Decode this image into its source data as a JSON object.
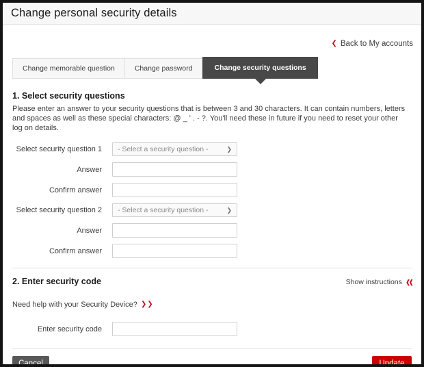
{
  "header": {
    "title": "Change personal security details"
  },
  "back_link": {
    "label": "Back to My accounts",
    "icon": "chevron-left-icon"
  },
  "tabs": [
    {
      "label": "Change memorable question",
      "active": false
    },
    {
      "label": "Change password",
      "active": false
    },
    {
      "label": "Change security questions",
      "active": true
    }
  ],
  "section1": {
    "heading": "1. Select security questions",
    "intro": "Please enter an answer to your security questions that is between 3 and 30 characters. It can contain numbers, letters and spaces as well as these special characters: @ _ ' . - ?. You'll need these in future if you need to reset your other log on details.",
    "fields": [
      {
        "label": "Select security question 1",
        "type": "select",
        "value": "- Select a security question -"
      },
      {
        "label": "Answer",
        "type": "text",
        "value": "",
        "placeholder": ""
      },
      {
        "label": "Confirm answer",
        "type": "text",
        "value": "",
        "placeholder": ""
      },
      {
        "label": "Select security question 2",
        "type": "select",
        "value": "- Select a security question -"
      },
      {
        "label": "Answer",
        "type": "text",
        "value": "",
        "placeholder": ""
      },
      {
        "label": "Confirm answer",
        "type": "text",
        "value": "",
        "placeholder": ""
      }
    ]
  },
  "section2": {
    "heading": "2. Enter security code",
    "show_instructions": "Show instructions",
    "help_link": "Need help with your Security Device?",
    "code_label": "Enter security code",
    "code_value": "",
    "code_placeholder": ""
  },
  "footer": {
    "cancel_label": "Cancel",
    "update_label": "Update"
  },
  "colors": {
    "accent_red": "#d0021b",
    "update_button": "#cc0000",
    "cancel_button": "#585858",
    "active_tab": "#484848"
  }
}
